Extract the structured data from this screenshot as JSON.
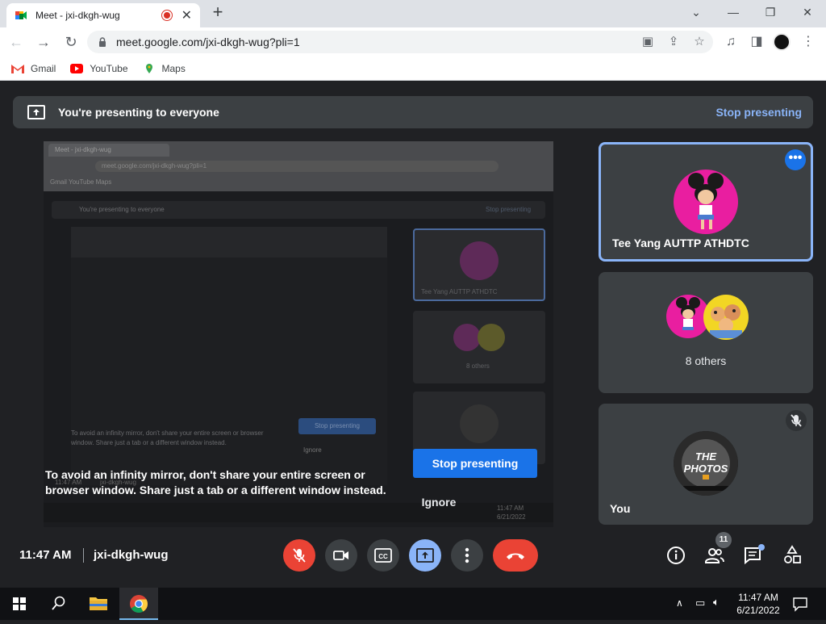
{
  "browser": {
    "tab_title": "Meet - jxi-dkgh-wug",
    "url": "meet.google.com/jxi-dkgh-wug?pli=1",
    "bookmarks": [
      "Gmail",
      "YouTube",
      "Maps"
    ]
  },
  "meet": {
    "presenting_banner": {
      "text": "You're presenting to everyone",
      "stop_label": "Stop presenting"
    },
    "mirror_warning": {
      "text": "To avoid an infinity mirror, don't share your entire screen or browser window. Share just a tab or a different window instead.",
      "stop_label": "Stop presenting",
      "ignore_label": "Ignore"
    },
    "participants": [
      {
        "name": "Tee Yang AUTTP ATHDTC"
      },
      {
        "name": "8 others"
      },
      {
        "name": "You"
      }
    ],
    "thumbnail_text": {
      "avatar_lettering": "THE PHOTOS"
    },
    "footer": {
      "time": "11:47 AM",
      "meeting_code": "jxi-dkgh-wug",
      "participant_count": "11"
    }
  },
  "mirror": {
    "tab_title": "Meet - jxi-dkgh-wug",
    "url": "meet.google.com/jxi-dkgh-wug?pli=1",
    "bookmarks": "Gmail   YouTube   Maps",
    "banner_text": "You're presenting to everyone",
    "banner_stop": "Stop presenting",
    "participant": "Tee Yang AUTTP ATHDTC",
    "others": "8 others",
    "warning": "To avoid an infinity mirror, don't share your entire screen or browser window. Share just a tab or a different window instead.",
    "stop": "Stop presenting",
    "ignore": "Ignore",
    "time": "11:47 AM",
    "code": "jxi-dkgh-wug",
    "tray_time": "11:47 AM",
    "tray_date": "6/21/2022"
  },
  "taskbar": {
    "time": "11:47 AM",
    "date": "6/21/2022"
  },
  "colors": {
    "meet_bg": "#202124",
    "tile_bg": "#3c4043",
    "accent_blue": "#1a73e8",
    "light_blue": "#8ab4f8",
    "red": "#ea4335"
  }
}
